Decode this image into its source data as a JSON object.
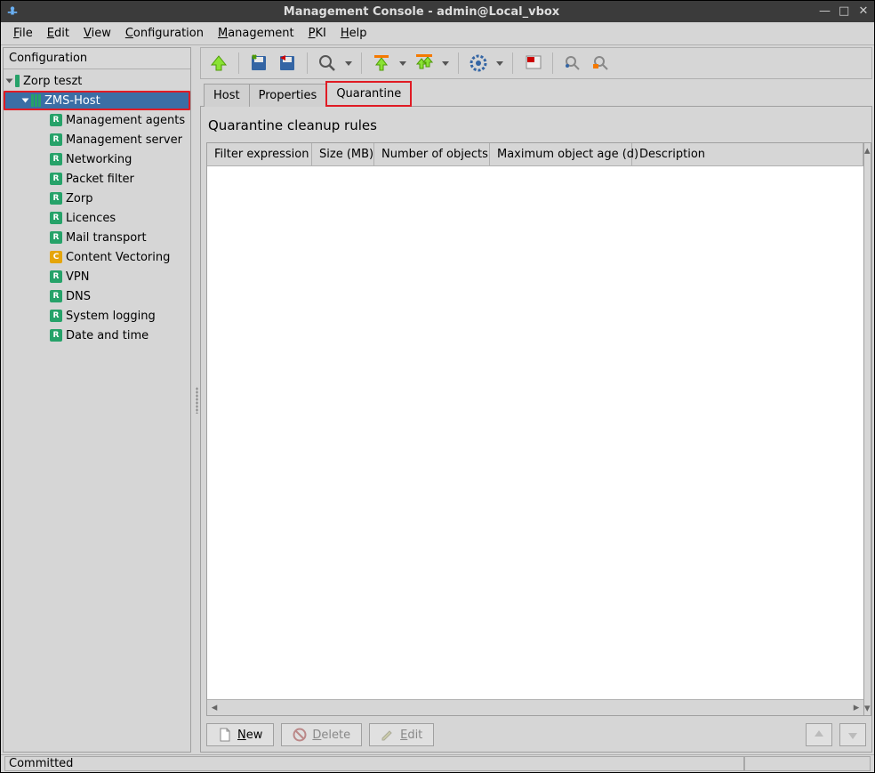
{
  "window": {
    "title": "Management Console - admin@Local_vbox"
  },
  "menubar": [
    {
      "label": "File",
      "u": 0
    },
    {
      "label": "Edit",
      "u": 0
    },
    {
      "label": "View",
      "u": 0
    },
    {
      "label": "Configuration",
      "u": 0
    },
    {
      "label": "Management",
      "u": 0
    },
    {
      "label": "PKI",
      "u": 0
    },
    {
      "label": "Help",
      "u": 0
    }
  ],
  "sidebar": {
    "header": "Configuration",
    "root": {
      "label": "Zorp teszt"
    },
    "host": {
      "label": "ZMS-Host"
    },
    "items": [
      {
        "label": "Management agents",
        "badge": "R",
        "color": "green"
      },
      {
        "label": "Management server",
        "badge": "R",
        "color": "green"
      },
      {
        "label": "Networking",
        "badge": "R",
        "color": "green"
      },
      {
        "label": "Packet filter",
        "badge": "R",
        "color": "green"
      },
      {
        "label": "Zorp",
        "badge": "R",
        "color": "green"
      },
      {
        "label": "Licences",
        "badge": "R",
        "color": "green"
      },
      {
        "label": "Mail transport",
        "badge": "R",
        "color": "green"
      },
      {
        "label": "Content Vectoring",
        "badge": "C",
        "color": "orange"
      },
      {
        "label": "VPN",
        "badge": "R",
        "color": "green"
      },
      {
        "label": "DNS",
        "badge": "R",
        "color": "green"
      },
      {
        "label": "System logging",
        "badge": "R",
        "color": "green"
      },
      {
        "label": "Date and time",
        "badge": "R",
        "color": "green"
      }
    ]
  },
  "tabs": [
    {
      "label": "Host",
      "active": false
    },
    {
      "label": "Properties",
      "active": false
    },
    {
      "label": "Quarantine",
      "active": true,
      "highlight": true
    }
  ],
  "main": {
    "heading": "Quarantine cleanup rules",
    "columns": [
      "Filter expression",
      "Size (MB)",
      "Number of objects",
      "Maximum object age (d)",
      "Description"
    ],
    "rows": []
  },
  "buttons": {
    "new": "New",
    "delete": "Delete",
    "edit": "Edit"
  },
  "status": "Committed"
}
